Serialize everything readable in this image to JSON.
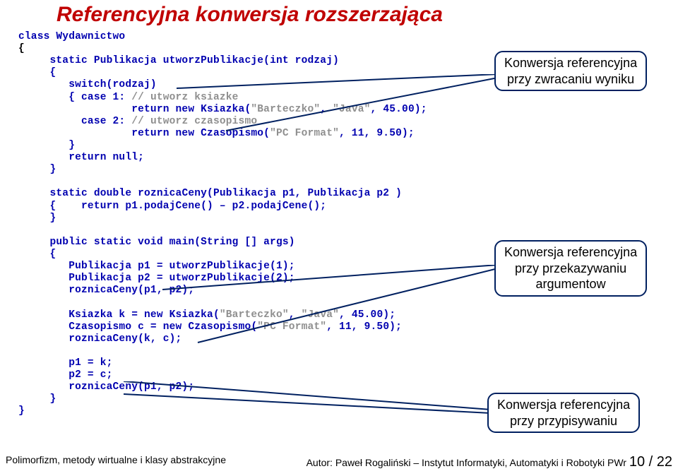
{
  "title": "Referencyjna konwersja rozszerzająca",
  "code": {
    "l01": "class Wydawnictwo",
    "l02": "{",
    "l03a": "     static Publikacja utworzPublikacje(",
    "l03b": "int",
    "l03c": " rodzaj)",
    "l04": "     {",
    "l05a": "        switch",
    "l05b": "(rodzaj)",
    "l06a": "        { ",
    "l06b": "case",
    "l06c": " 1: ",
    "l06d": "// utworz ksiazke",
    "l07a": "                  return new",
    "l07b": " Ksiazka(",
    "l07c": "\"Barteczko\"",
    "l07d": ", ",
    "l07e": "\"Java\"",
    "l07f": ", 45.00);",
    "l08a": "          case",
    "l08b": " 2: ",
    "l08c": "// utworz czasopismo",
    "l09a": "                  return new",
    "l09b": " Czasopismo(",
    "l09c": "\"PC Format\"",
    "l09d": ", 11, 9.50);",
    "l10": "        }",
    "l11a": "        return ",
    "l11b": "null",
    "l11c": ";",
    "l12": "     }",
    "l13": "",
    "l14a": "     static double",
    "l14b": " roznicaCeny(Publikacja p1, Publikacja p2 )",
    "l15a": "     {    ",
    "l15b": "return",
    "l15c": " p1.podajCene() – p2.podajCene();",
    "l16": "     }",
    "l17": "",
    "l18a": "     public static void",
    "l18b": " main(String [] args)",
    "l19": "     {",
    "l20": "        Publikacja p1 = utworzPublikacje(1);",
    "l21": "        Publikacja p2 = utworzPublikacje(2);",
    "l22": "        roznicaCeny(p1, p2);",
    "l23": "",
    "l24a": "        Ksiazka k = ",
    "l24b": "new",
    "l24c": " Ksiazka(",
    "l24d": "\"Barteczko\"",
    "l24e": ", ",
    "l24f": "\"Java\"",
    "l24g": ", 45.00);",
    "l25a": "        Czasopismo c = ",
    "l25b": "new",
    "l25c": " Czasopismo(",
    "l25d": "\"PC Format\"",
    "l25e": ", 11, 9.50);",
    "l26": "        roznicaCeny(k, c);",
    "l27": "",
    "l28": "        p1 = k;",
    "l29": "        p2 = c;",
    "l30": "        roznicaCeny(p1, p2);",
    "l31": "     }",
    "l32": "}"
  },
  "callouts": {
    "c1l1": "Konwersja referencyjna",
    "c1l2": "przy zwracaniu wyniku",
    "c2l1": "Konwersja referencyjna",
    "c2l2": "przy  przekazywaniu",
    "c2l3": "argumentow",
    "c3l1": "Konwersja referencyjna",
    "c3l2": "przy  przypisywaniu"
  },
  "footer": {
    "left": "Polimorfizm, metody wirtualne i klasy abstrakcyjne",
    "right_prefix": "Autor: Paweł Rogaliński – Instytut Informatyki, Automatyki i Robotyki PWr ",
    "page": "10 / 22"
  }
}
